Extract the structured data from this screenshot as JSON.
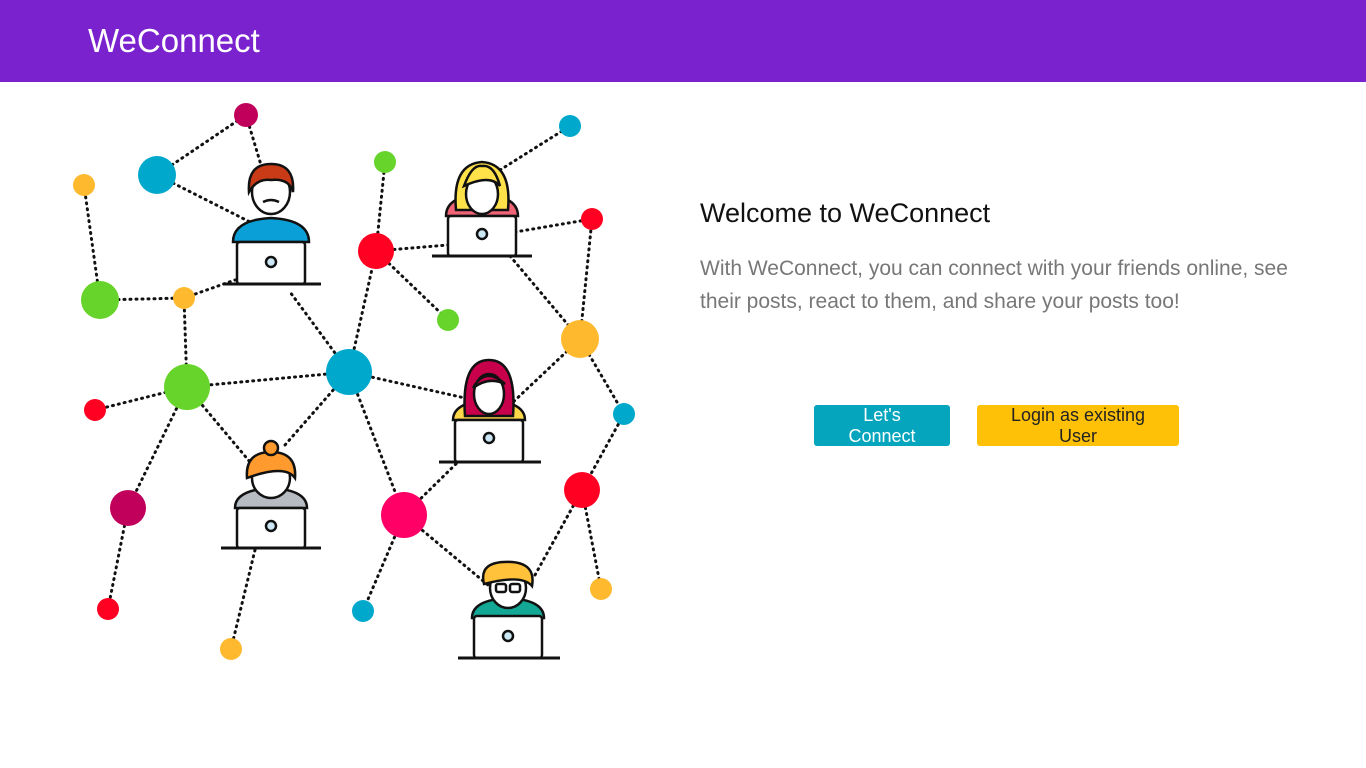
{
  "navbar": {
    "brand": "WeConnect"
  },
  "hero": {
    "illustration": "people-network-illustration",
    "title": "Welcome to WeConnect",
    "description": "With WeConnect, you can connect with your friends online, see their posts, react to them, and share your posts too!"
  },
  "actions": {
    "connect_label": "Let's Connect",
    "login_label": "Login as existing User"
  },
  "colors": {
    "navbar": "#7b22cf",
    "primary_button": "#04a5bd",
    "warning_button": "#ffc107",
    "dot_red": "#ff0022",
    "dot_blue": "#00a8cc",
    "dot_green": "#66d42a",
    "dot_yellow": "#ffb92e",
    "dot_magenta": "#c0005a",
    "dot_pink": "#ff0066"
  }
}
